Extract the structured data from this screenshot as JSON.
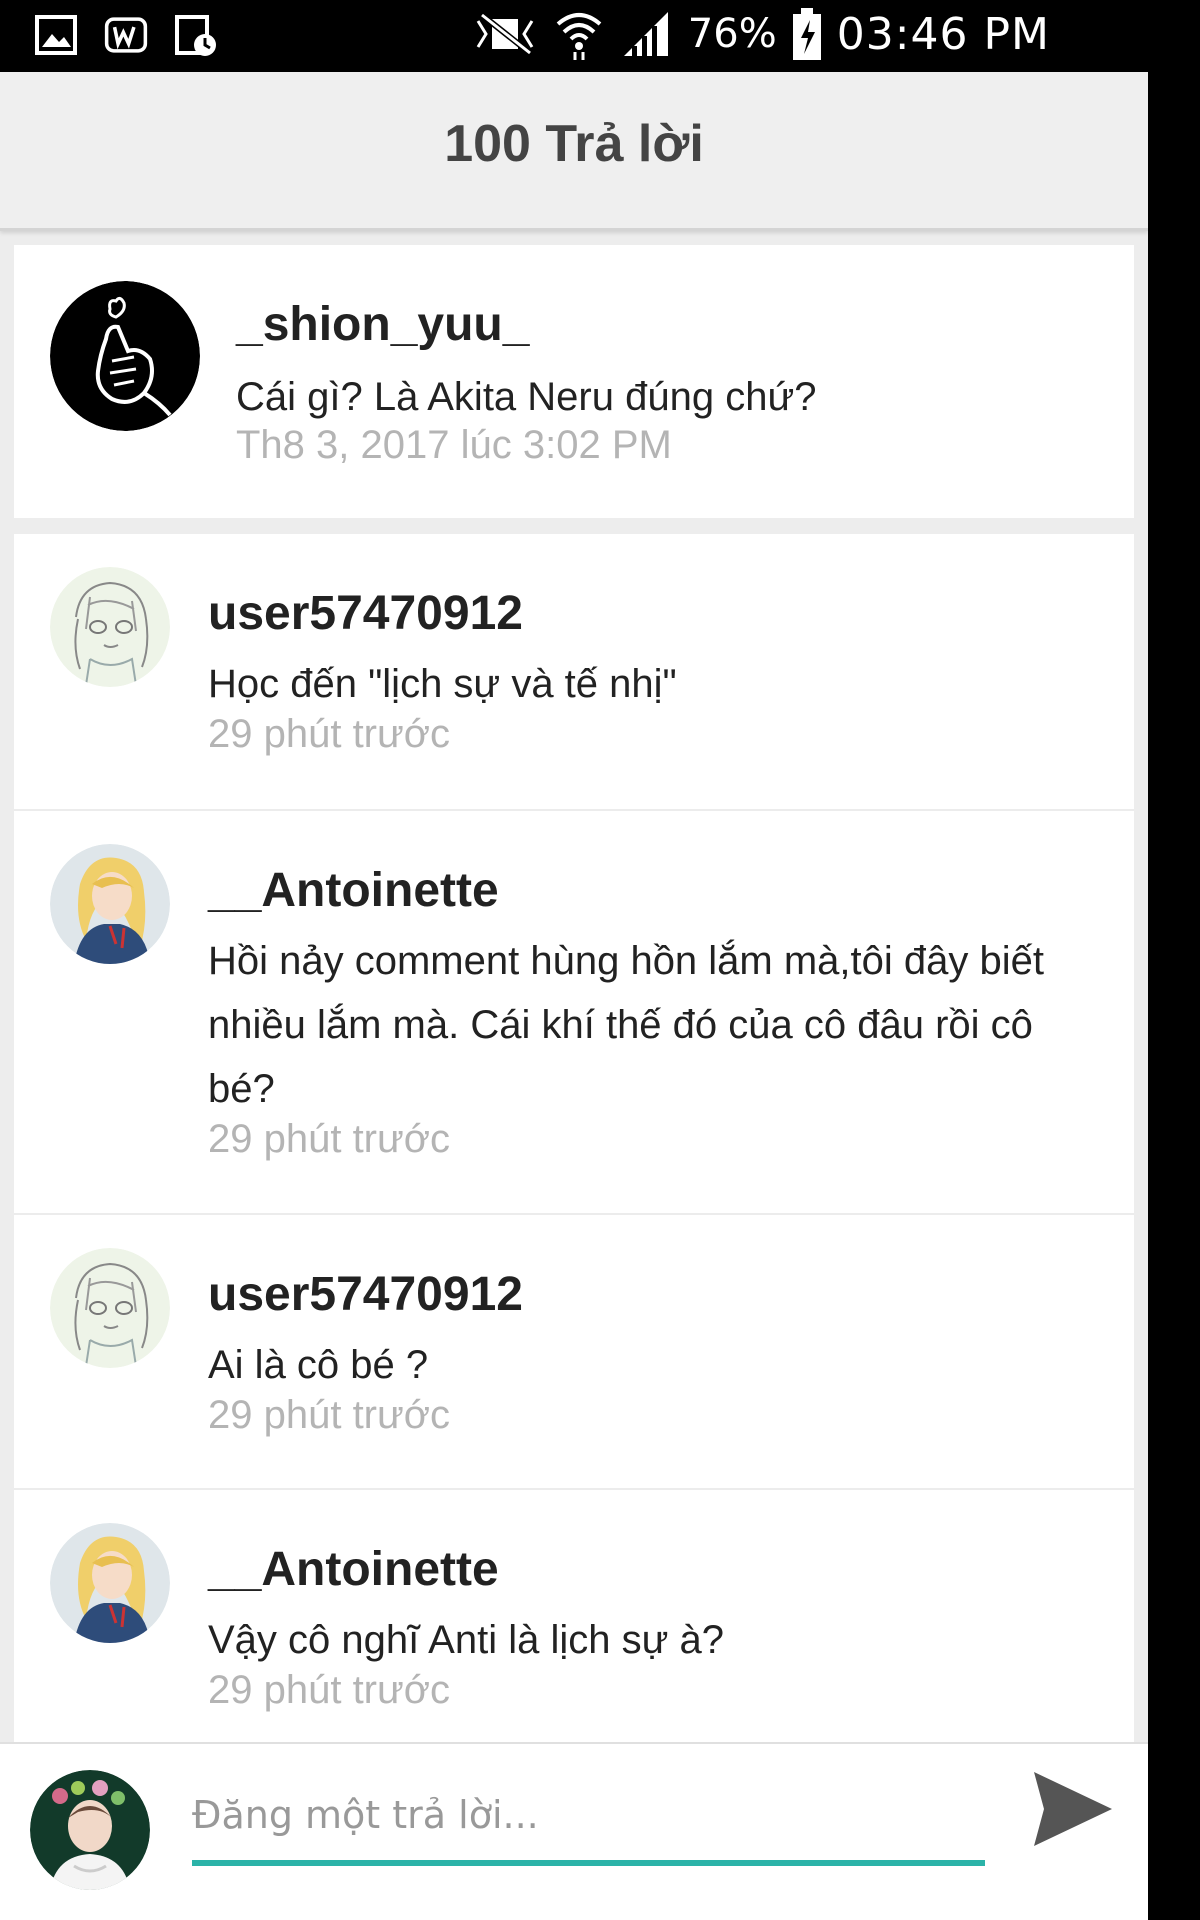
{
  "status_bar": {
    "battery_percent": "76%",
    "time": "03:46 PM",
    "icons": [
      "gallery-icon",
      "app-w-icon",
      "calendar-clock-icon",
      "mute-icon",
      "wifi-icon",
      "signal-icon",
      "battery-charging-icon"
    ]
  },
  "header": {
    "title": "100 Trả lời"
  },
  "post": {
    "username": "_shion_yuu_",
    "message": "Cái gì? Là Akita Neru đúng chứ?",
    "timestamp": "Th8 3, 2017 lúc 3:02 PM",
    "avatar": "heart-hand-avatar"
  },
  "replies": [
    {
      "username": "user57470912",
      "message": "Học đến \"lịch sự và tế nhị\"",
      "timestamp": "29 phút trước",
      "avatar": "sketch-girl-avatar"
    },
    {
      "username": "__Antoinette",
      "message": "Hồi nảy comment hùng hồn lắm mà,tôi đây biết nhiều lắm mà. Cái khí thế đó của cô đâu rồi cô bé?",
      "timestamp": "29 phút trước",
      "avatar": "blonde-girl-avatar"
    },
    {
      "username": "user57470912",
      "message": "Ai là cô bé ?",
      "timestamp": "29 phút trước",
      "avatar": "sketch-girl-avatar"
    },
    {
      "username": "__Antoinette",
      "message": "Vậy cô nghĩ Anti là lịch sự à?",
      "timestamp": "29 phút trước",
      "avatar": "blonde-girl-avatar"
    }
  ],
  "composer": {
    "placeholder": "Đăng một trả lời...",
    "value": "",
    "accent_color": "#2bb3a8"
  }
}
